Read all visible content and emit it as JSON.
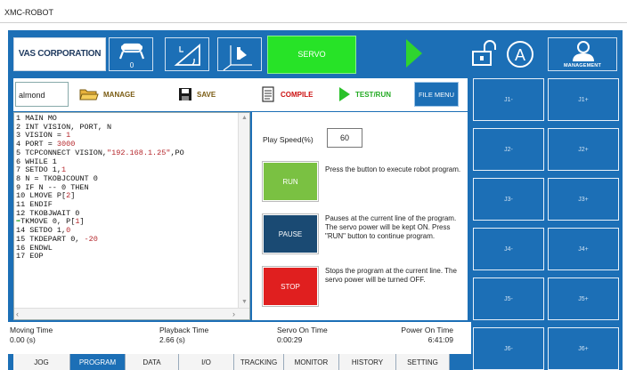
{
  "window": {
    "title": "XMC-ROBOT"
  },
  "toolbar": {
    "company": "VAS CORPORATION",
    "coord_badge": "0",
    "servo_label": "SERVO",
    "management_label": "MANAGEMENT",
    "colors": {
      "servo": "#27e327",
      "run_arrow": "#2fd42f",
      "background": "#1c6fb6"
    }
  },
  "filebar": {
    "program_name": "almond",
    "manage_label": "MANAGE",
    "save_label": "SAVE",
    "compile_label": "COMPILE",
    "testrun_label": "TEST/RUN",
    "filemenu_label": "FILE MENU"
  },
  "editor": {
    "lines": [
      "1 MAIN MO",
      "2 INT VISION, PORT, N",
      "3 VISION = 1",
      "4 PORT = 3000",
      "5 TCPCONNECT VISION,\"192.168.1.25\",PO",
      "6 WHILE 1",
      "7 SETDO 1,1",
      "8 N = TKOBJCOUNT 0",
      "9 IF N -- 0 THEN",
      "10 LMOVE P[2]",
      "11 ENDIF",
      "12 TKOBJWAIT 0",
      "TKMOVE 0, P[1]",
      "14 SETDO 1,0",
      "15 TKDEPART 0, -20",
      "16 ENDWL",
      "17 EOP"
    ]
  },
  "controls": {
    "speed_label": "Play Speed(%)",
    "speed_value": "60",
    "run_label": "RUN",
    "run_desc": "Press the button to execute robot program.",
    "pause_label": "PAUSE",
    "pause_desc": "Pauses at the current line of the program. The servo power will be kept ON. Press \"RUN\" button to continue program.",
    "stop_label": "STOP",
    "stop_desc": "Stops the program at the current line. The servo power will be turned OFF."
  },
  "status": {
    "moving_label": "Moving Time",
    "moving_value": "0.00 (s)",
    "playback_label": "Playback Time",
    "playback_value": "2.66 (s)",
    "servo_label": "Servo On Time",
    "servo_value": "0:00:29",
    "power_label": "Power On Time",
    "power_value": "6:41:09"
  },
  "tabs": [
    "JOG",
    "PROGRAM",
    "DATA",
    "I/O",
    "TRACKING",
    "MONITOR",
    "HISTORY",
    "SETTING"
  ],
  "active_tab": "PROGRAM",
  "jog": {
    "minus": [
      "J1-",
      "J2-",
      "J3-",
      "J4-",
      "J5-",
      "J6-"
    ],
    "plus": [
      "J1+",
      "J2+",
      "J3+",
      "J4+",
      "J5+",
      "J6+"
    ]
  }
}
